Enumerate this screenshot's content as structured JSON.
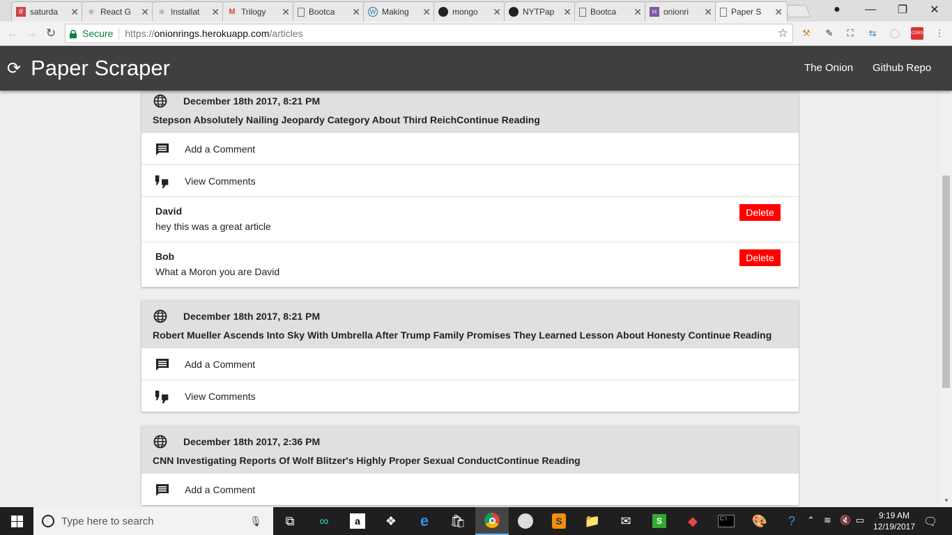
{
  "browser": {
    "tabs": [
      {
        "label": "saturda",
        "icon": "slack-icon"
      },
      {
        "label": "React G",
        "icon": "react-icon"
      },
      {
        "label": "Installat",
        "icon": "react-icon"
      },
      {
        "label": "Trilogy",
        "icon": "gmail-icon"
      },
      {
        "label": "Bootca",
        "icon": "page-icon"
      },
      {
        "label": "Making",
        "icon": "wordpress-icon"
      },
      {
        "label": "mongo",
        "icon": "github-icon"
      },
      {
        "label": "NYTPap",
        "icon": "github-icon"
      },
      {
        "label": "Bootca",
        "icon": "page-icon"
      },
      {
        "label": "onionri",
        "icon": "heroku-icon"
      },
      {
        "label": "Paper S",
        "icon": "page-icon",
        "active": true
      }
    ],
    "secure_label": "Secure",
    "url_scheme": "https://",
    "url_host": "onionrings.herokuapp.com",
    "url_path": "/articles"
  },
  "app": {
    "title": "Paper Scraper",
    "nav": [
      "The Onion",
      "Github Repo"
    ]
  },
  "articles": [
    {
      "date": "December 18th 2017, 8:21 PM",
      "headline": "Stepson Absolutely Nailing Jeopardy Category About Third ReichContinue Reading",
      "add_comment": "Add a Comment",
      "view_comments": "View Comments",
      "comments": [
        {
          "author": "David",
          "text": "hey this was a great article",
          "delete": "Delete"
        },
        {
          "author": "Bob",
          "text": "What a Moron you are David",
          "delete": "Delete"
        }
      ]
    },
    {
      "date": "December 18th 2017, 8:21 PM",
      "headline": "Robert Mueller Ascends Into Sky With Umbrella After Trump Family Promises They Learned Lesson About Honesty Continue Reading",
      "add_comment": "Add a Comment",
      "view_comments": "View Comments",
      "comments": []
    },
    {
      "date": "December 18th 2017, 2:36 PM",
      "headline": "CNN Investigating Reports Of Wolf Blitzer's Highly Proper Sexual ConductContinue Reading",
      "add_comment": "Add a Comment"
    }
  ],
  "taskbar": {
    "search_placeholder": "Type here to search",
    "time": "9:19 AM",
    "date": "12/19/2017"
  },
  "colors": {
    "appbar": "#3f3f3f",
    "delete": "#ff0000",
    "card_header": "#e0e0e0"
  }
}
